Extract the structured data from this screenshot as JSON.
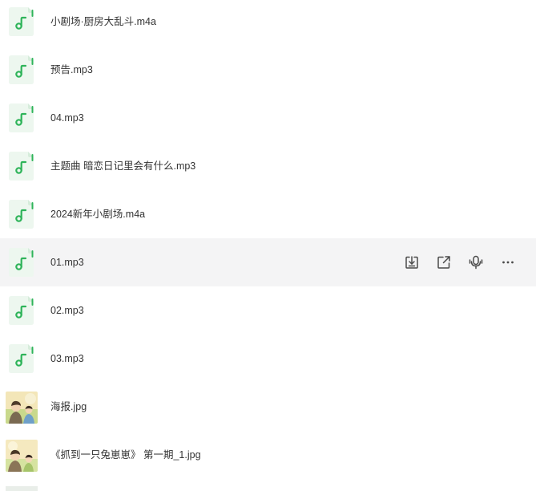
{
  "files": [
    {
      "name": "小剧场·厨房大乱斗.m4a",
      "type": "audio-icon"
    },
    {
      "name": "预告.mp3",
      "type": "audio-icon"
    },
    {
      "name": "04.mp3",
      "type": "audio-icon"
    },
    {
      "name": "主题曲 暗恋日记里会有什么.mp3",
      "type": "audio-icon"
    },
    {
      "name": "2024新年小剧场.m4a",
      "type": "audio-icon"
    },
    {
      "name": "01.mp3",
      "type": "audio-icon"
    },
    {
      "name": "02.mp3",
      "type": "audio-icon"
    },
    {
      "name": "03.mp3",
      "type": "audio-icon"
    },
    {
      "name": "海报.jpg",
      "type": "image-thumbnail"
    },
    {
      "name": "《抓到一只兔崽崽》 第一期_1.jpg",
      "type": "image-thumbnail"
    }
  ],
  "hovered_row_actions": [
    {
      "icon": "download-icon"
    },
    {
      "icon": "share-icon"
    },
    {
      "icon": "transcribe-icon"
    },
    {
      "icon": "more-icon"
    }
  ],
  "colors": {
    "audio_icon_bg": "#edf7ef",
    "audio_icon_accent": "#2fb45a",
    "hover_row_bg": "#f4f4f5",
    "action_icon": "#4a4a4a"
  }
}
